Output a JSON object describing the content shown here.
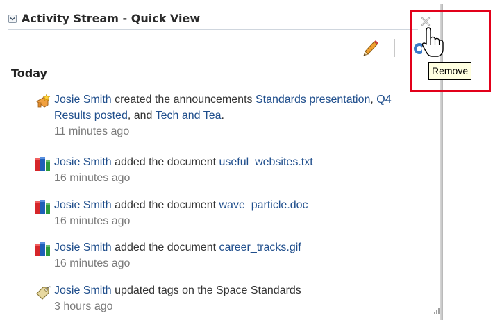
{
  "header": {
    "title": "Activity Stream - Quick View"
  },
  "section": {
    "title": "Today"
  },
  "items": [
    {
      "icon": "announcement-icon",
      "actor": "Josie Smith",
      "text_before": " created the announcements ",
      "link1": "Standards presentation",
      "sep1": ", ",
      "link2": "Q4 Results posted",
      "sep2": ", and ",
      "link3": "Tech and Tea",
      "end": ".",
      "time": "11 minutes ago"
    },
    {
      "icon": "document-books-icon",
      "actor": "Josie Smith",
      "text": " added the document ",
      "link": "useful_websites.txt",
      "time": "16 minutes ago"
    },
    {
      "icon": "document-books-icon",
      "actor": "Josie Smith",
      "text": " added the document ",
      "link": "wave_particle.doc",
      "time": "16 minutes ago"
    },
    {
      "icon": "document-books-icon",
      "actor": "Josie Smith",
      "text": " added the document ",
      "link": "career_tracks.gif",
      "time": "16 minutes ago"
    },
    {
      "icon": "tag-icon",
      "actor": "Josie Smith",
      "text": " updated tags on the Space Standards",
      "time": "3 hours ago"
    }
  ],
  "tooltip": {
    "text": "Remove"
  },
  "colors": {
    "link": "#1f4e8c",
    "highlight": "#e2001a",
    "tooltip_bg": "#ffffe1"
  }
}
